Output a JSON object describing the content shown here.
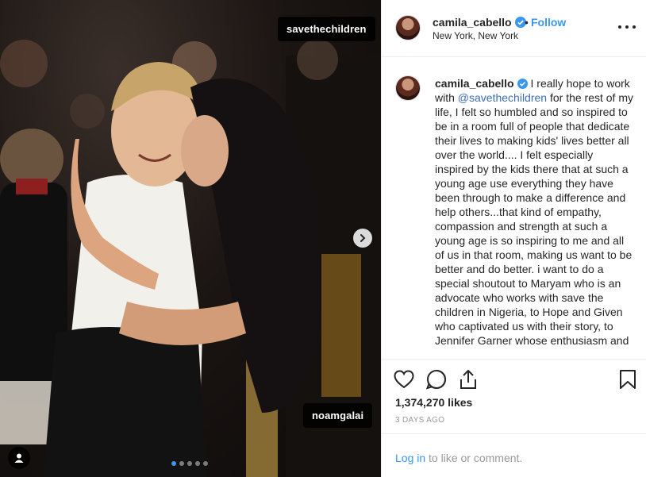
{
  "photo": {
    "tag_top": "savethechildren",
    "tag_bottom": "noamgalai",
    "carousel_count": 5,
    "carousel_active": 1
  },
  "header": {
    "username": "camila_cabello",
    "separator": "•",
    "follow_label": "Follow",
    "location": "New York, New York"
  },
  "caption": {
    "username": "camila_cabello",
    "text_before_mention": "I really hope to work with ",
    "mention": "@savethechildren",
    "text_after_mention": " for the rest of my life, I felt so humbled and so inspired to be in a room full of people that dedicate their lives to making kids' lives better all over the world.... I felt especially inspired by the kids there that at such a young age use everything they have been through to make a difference and help others...that kind of empathy, compassion and strength at such a young age is so inspiring to me and all of us in that room, making us want to be better and do better. i want to do a special shoutout to Maryam who is an advocate who works with save the children in Nigeria, to Hope and Given who captivated us with their story, to Jennifer Garner whose enthusiasm and"
  },
  "stats": {
    "likes": "1,374,270 likes",
    "date": "3 DAYS AGO"
  },
  "comment_bar": {
    "login_label": "Log in",
    "rest": " to like or comment."
  },
  "colors": {
    "accent": "#3897f0",
    "muted": "#999999",
    "text": "#262626",
    "border": "#efefef"
  },
  "icons": [
    "chevron-right-icon",
    "user-tag-icon",
    "verified-badge-icon",
    "heart-icon",
    "comment-icon",
    "share-icon",
    "bookmark-icon",
    "more-options-icon"
  ]
}
